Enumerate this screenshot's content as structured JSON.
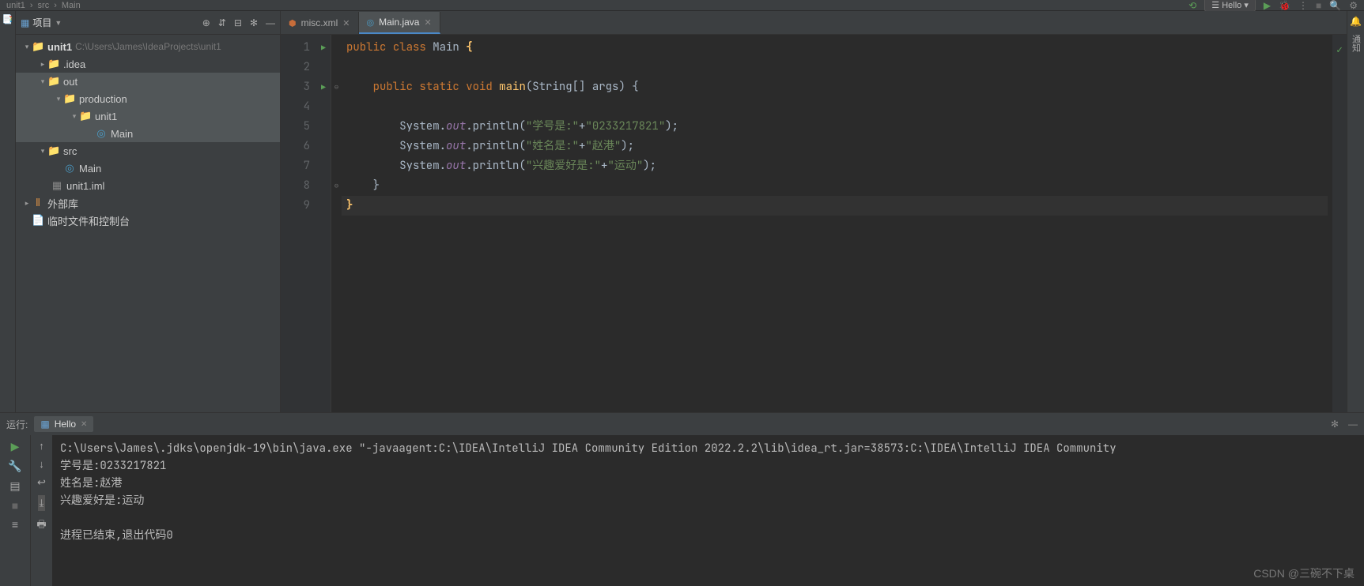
{
  "topbar": {
    "breadcrumb": [
      "unit1",
      "src",
      "Main"
    ],
    "run_config": "Hello"
  },
  "sidebar": {
    "title": "项目",
    "root_name": "unit1",
    "root_path": "C:\\Users\\James\\IdeaProjects\\unit1",
    "idea_folder": ".idea",
    "out_folder": "out",
    "production_folder": "production",
    "unit1_folder": "unit1",
    "main_class1": "Main",
    "src_folder": "src",
    "main_class2": "Main",
    "iml_file": "unit1.iml",
    "libraries": "外部库",
    "scratches": "临时文件和控制台"
  },
  "tabs": {
    "tab1": "misc.xml",
    "tab2": "Main.java"
  },
  "code": {
    "lines": [
      1,
      2,
      3,
      4,
      5,
      6,
      7,
      8,
      9
    ],
    "l1_kw1": "public",
    "l1_kw2": "class",
    "l1_cls": "Main",
    "l3_kw1": "public",
    "l3_kw2": "static",
    "l3_kw3": "void",
    "l3_m": "main",
    "l3_args": "(String[] args) {",
    "l5_obj": "System.",
    "l5_fld": "out",
    "l5_call": ".println(",
    "l5_s1": "\"学号是:\"",
    "l5_plus": "+",
    "l5_s2": "\"0233217821\"",
    "l5_end": ");",
    "l6_s1": "\"姓名是:\"",
    "l6_s2": "\"赵港\"",
    "l7_s1": "\"兴趣爱好是:\"",
    "l7_s2": "\"运动\""
  },
  "run_panel": {
    "title": "运行:",
    "tab": "Hello",
    "cmd": "C:\\Users\\James\\.jdks\\openjdk-19\\bin\\java.exe \"-javaagent:C:\\IDEA\\IntelliJ IDEA Community Edition 2022.2.2\\lib\\idea_rt.jar=38573:C:\\IDEA\\IntelliJ IDEA Community",
    "line1": "学号是:0233217821",
    "line2": "姓名是:赵港",
    "line3": "兴趣爱好是:运动",
    "exit": "进程已结束,退出代码0"
  },
  "watermark": "CSDN @三碗不下桌"
}
